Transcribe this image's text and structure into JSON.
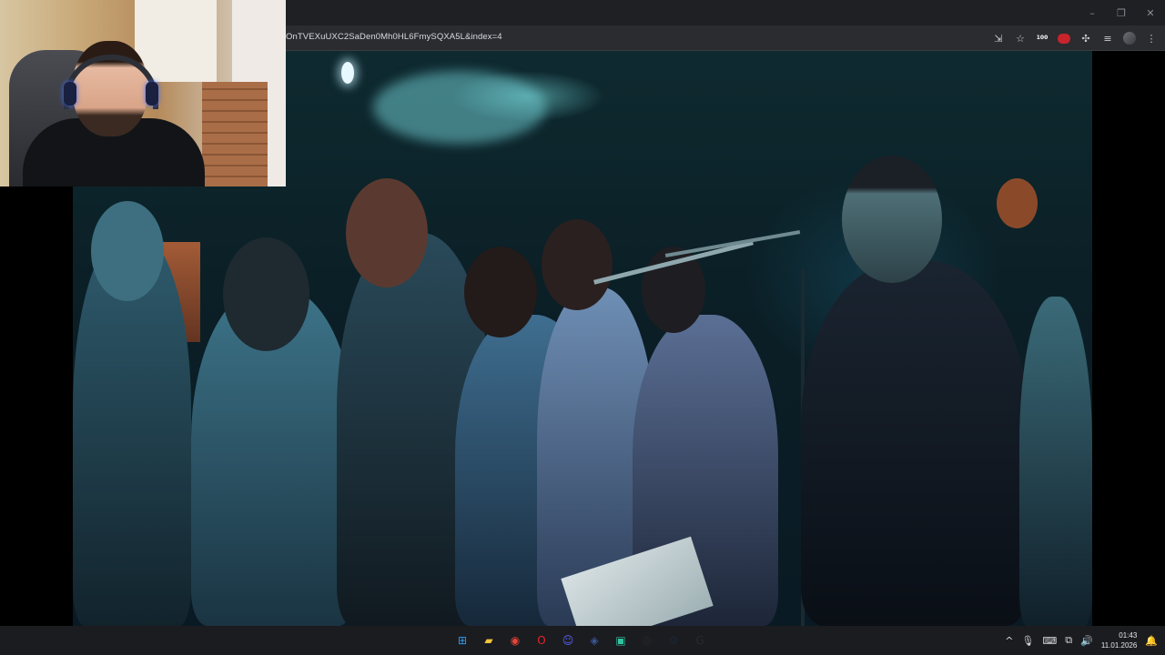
{
  "browser": {
    "url": "OnTVEXuUXC2SaDen0Mh0HL6FmySQXA5L&index=4",
    "window_controls": {
      "minimize": "–",
      "restore": "❐",
      "close": "✕"
    },
    "toolbar_icons": {
      "install_icon": "install-app-icon",
      "bookmark_icon": "star-icon",
      "ext_badge": "100",
      "extensions_icon": "puzzle-icon",
      "media_icon": "media-control-icon",
      "menu_icon": "kebab-menu-icon"
    }
  },
  "video": {
    "description_colors": {
      "teal": "#0e2a30",
      "smoke": "#6ec8cd"
    }
  },
  "taskbar": {
    "apps": [
      {
        "name": "start",
        "icon": "windows-icon",
        "color": "#2e9bf0"
      },
      {
        "name": "file-explorer",
        "icon": "folder-icon",
        "color": "#f2c53d"
      },
      {
        "name": "chrome",
        "icon": "chrome-icon",
        "color": "#e6453a"
      },
      {
        "name": "opera",
        "icon": "opera-icon",
        "color": "#e2242b"
      },
      {
        "name": "discord",
        "icon": "discord-icon",
        "color": "#5865f2"
      },
      {
        "name": "app-cube",
        "icon": "cube-icon",
        "color": "#3b5a9a"
      },
      {
        "name": "streamlabs",
        "icon": "streamlabs-icon",
        "color": "#31c3a2"
      },
      {
        "name": "obs",
        "icon": "obs-icon",
        "color": "#2a2a2e"
      },
      {
        "name": "steam",
        "icon": "steam-icon",
        "color": "#1b2838"
      },
      {
        "name": "g-hub",
        "icon": "g-icon",
        "color": "#2a2a2e"
      }
    ],
    "tray": {
      "chevron": "^",
      "time": "01:43",
      "date": "11.01.2026"
    }
  }
}
